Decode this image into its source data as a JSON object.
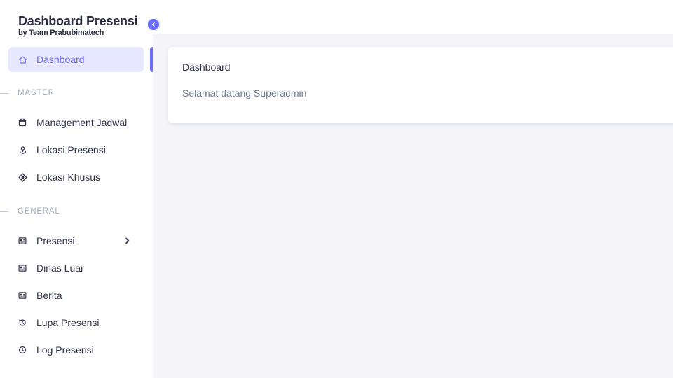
{
  "brand": {
    "title": "Dashboard Presensi",
    "subtitle": "by Team Prabubimatech"
  },
  "colors": {
    "accent": "#696cff",
    "active_bg": "#e7e7ff",
    "page_bg": "#f5f5f9"
  },
  "sidebar": {
    "items": [
      {
        "label": "Dashboard",
        "icon": "home-icon",
        "active": true
      },
      {
        "label": "Management Jadwal",
        "icon": "calendar-icon"
      },
      {
        "label": "Lokasi Presensi",
        "icon": "location-icon"
      },
      {
        "label": "Lokasi Khusus",
        "icon": "target-icon"
      },
      {
        "label": "Presensi",
        "icon": "id-card-icon",
        "has_submenu": true
      },
      {
        "label": "Dinas Luar",
        "icon": "id-card-icon"
      },
      {
        "label": "Berita",
        "icon": "id-card-icon"
      },
      {
        "label": "Lupa Presensi",
        "icon": "history-icon"
      },
      {
        "label": "Log Presensi",
        "icon": "clock-icon"
      }
    ],
    "headers": {
      "master": "MASTER",
      "general": "GENERAL"
    }
  },
  "card": {
    "title": "Dashboard",
    "text": "Selamat datang Superadmin"
  }
}
